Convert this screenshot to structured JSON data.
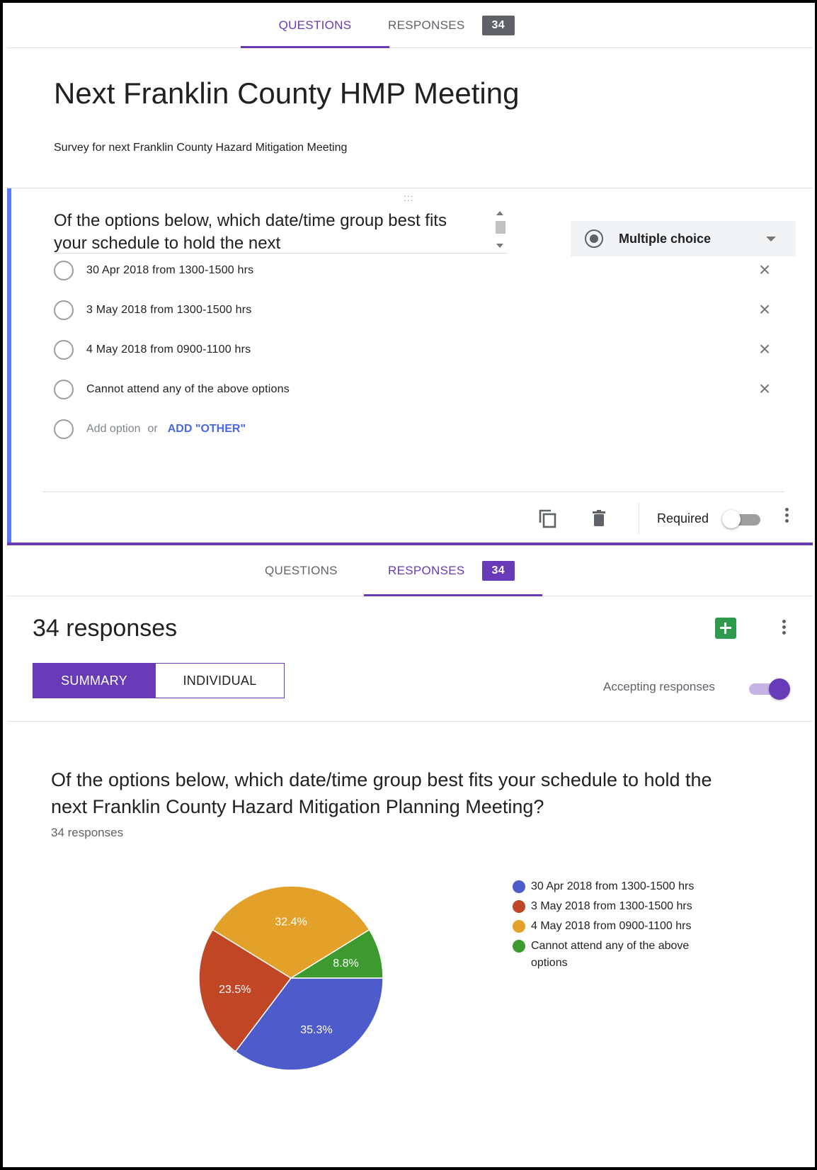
{
  "tabs": {
    "questions": "QUESTIONS",
    "responses": "RESPONSES",
    "responses_badge": "34"
  },
  "form": {
    "title": "Next Franklin County HMP Meeting",
    "description": "Survey for next Franklin County Hazard Mitigation Meeting"
  },
  "question_editor": {
    "question_text": "Of the options below, which date/time group best fits your schedule to hold the next",
    "type_label": "Multiple choice",
    "options": [
      "30 Apr 2018 from 1300-1500 hrs",
      "3 May 2018 from 1300-1500 hrs",
      "4 May 2018 from 0900-1100 hrs",
      "Cannot attend any of the above options"
    ],
    "add_option": "Add option",
    "or": "or",
    "add_other": "ADD \"OTHER\"",
    "required_label": "Required",
    "required_on": false,
    "icons": [
      "drag-handle-icon",
      "scroll-up-icon",
      "scroll-down-icon",
      "radio-icon",
      "chevron-down-icon",
      "close-icon",
      "copy-icon",
      "trash-icon",
      "more-vert-icon"
    ]
  },
  "responses_panel": {
    "count_title": "34 responses",
    "summary_tab": "SUMMARY",
    "individual_tab": "INDIVIDUAL",
    "accepting_label": "Accepting responses",
    "accepting_on": true,
    "icons": [
      "sheets-icon",
      "more-vert-icon"
    ]
  },
  "summary": {
    "question": "Of the options below, which date/time group best fits your schedule to hold the next Franklin County Hazard Mitigation Planning Meeting?",
    "response_count": "34 responses"
  },
  "colors": {
    "accent": "#673ab7",
    "question_bar": "#5b7cf0",
    "add_other": "#4a67e4"
  },
  "chart_data": {
    "type": "pie",
    "categories": [
      "30 Apr 2018 from 1300-1500 hrs",
      "3 May 2018 from 1300-1500 hrs",
      "4 May 2018 from 0900-1100 hrs",
      "Cannot attend any of the above options"
    ],
    "values": [
      35.3,
      23.5,
      32.4,
      8.8
    ],
    "labels": [
      "35.3%",
      "23.5%",
      "32.4%",
      "8.8%"
    ],
    "colors": [
      "#4e5bcb",
      "#c04625",
      "#e3a12a",
      "#3c9a2f"
    ],
    "legend": "right"
  }
}
